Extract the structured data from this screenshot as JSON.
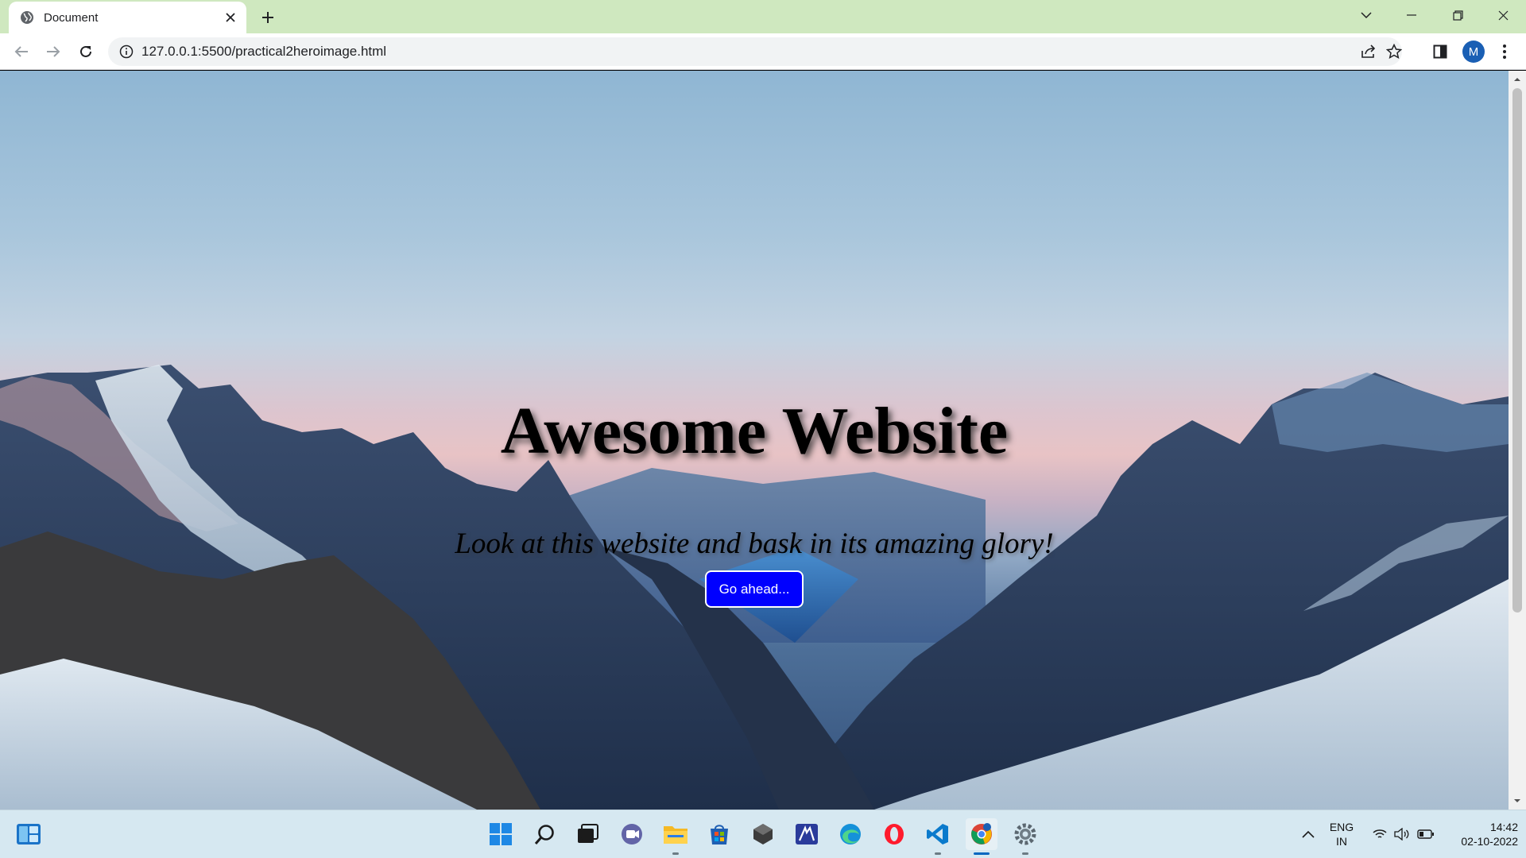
{
  "browser": {
    "tab_title": "Document",
    "url": "127.0.0.1:5500/practical2heroimage.html",
    "profile_initial": "M"
  },
  "hero": {
    "title": "Awesome Website",
    "subtitle": "Look at this website and bask in its amazing glory!",
    "button_label": "Go ahead..."
  },
  "taskbar": {
    "apps": [
      "start-icon",
      "search-icon",
      "task-view-icon",
      "teams-chat-icon",
      "file-explorer-icon",
      "microsoft-store-icon",
      "app-dark-icon",
      "app-blue-icon",
      "edge-icon",
      "opera-icon",
      "vscode-icon",
      "chrome-icon",
      "settings-icon"
    ],
    "lang_top": "ENG",
    "lang_bottom": "IN",
    "time": "14:42",
    "date": "02-10-2022"
  },
  "colors": {
    "tab_strip": "#cfe8bf",
    "hero_button": "#0000ff",
    "taskbar": "#d6e8f1"
  }
}
